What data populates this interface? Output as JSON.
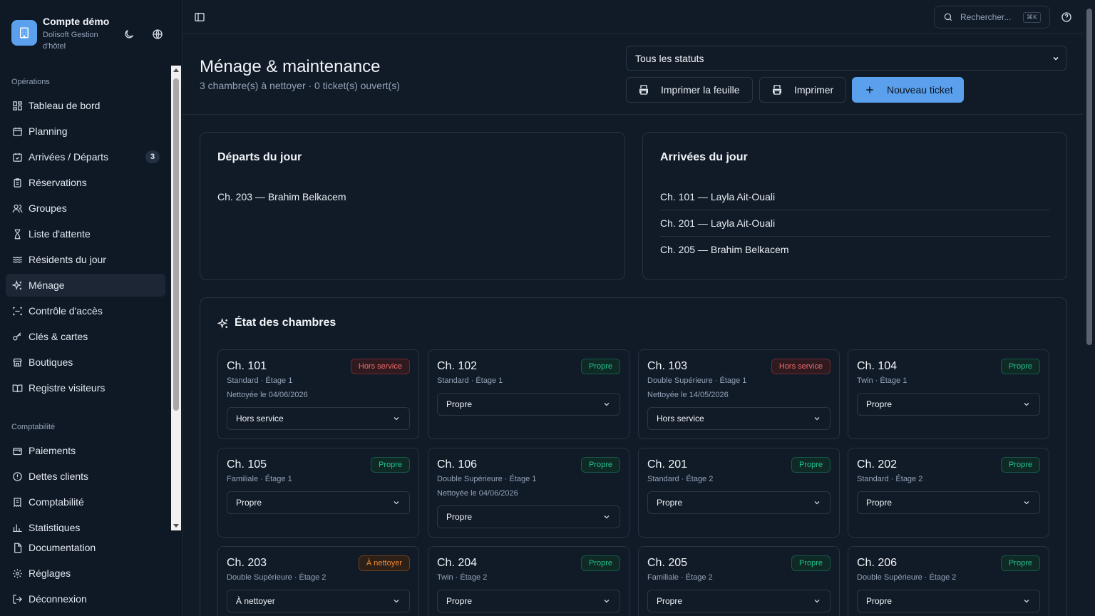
{
  "brand": {
    "title": "Compte démo",
    "subtitle": "Dolisoft Gestion d'hôtel"
  },
  "sidebar": {
    "operations_label": "Opérations",
    "operations": [
      {
        "label": "Tableau de bord",
        "icon": "dashboard-icon"
      },
      {
        "label": "Planning",
        "icon": "calendar-icon"
      },
      {
        "label": "Arrivées / Départs",
        "icon": "calendar-check-icon",
        "badge": "3"
      },
      {
        "label": "Réservations",
        "icon": "clipboard-icon"
      },
      {
        "label": "Groupes",
        "icon": "users-icon"
      },
      {
        "label": "Liste d'attente",
        "icon": "hourglass-icon"
      },
      {
        "label": "Résidents du jour",
        "icon": "waves-icon"
      },
      {
        "label": "Ménage",
        "icon": "sparkles-icon",
        "active": true
      },
      {
        "label": "Contrôle d'accès",
        "icon": "scan-icon"
      },
      {
        "label": "Clés & cartes",
        "icon": "key-icon"
      },
      {
        "label": "Boutiques",
        "icon": "store-icon"
      },
      {
        "label": "Registre visiteurs",
        "icon": "book-icon"
      }
    ],
    "accounting_label": "Comptabilité",
    "accounting": [
      {
        "label": "Paiements",
        "icon": "wallet-icon"
      },
      {
        "label": "Dettes clients",
        "icon": "alert-circle-icon"
      },
      {
        "label": "Comptabilité",
        "icon": "receipt-icon"
      },
      {
        "label": "Statistiques",
        "icon": "bar-chart-icon"
      }
    ],
    "footer": [
      {
        "label": "Documentation",
        "icon": "doc-icon"
      },
      {
        "label": "Réglages",
        "icon": "gear-icon"
      },
      {
        "label": "Déconnexion",
        "icon": "logout-icon"
      }
    ]
  },
  "topbar": {
    "search_placeholder": "Rechercher...",
    "search_shortcut": "⌘K"
  },
  "header": {
    "title": "Ménage & maintenance",
    "subtitle": "3 chambre(s) à nettoyer · 0 ticket(s) ouvert(s)",
    "status_filter": "Tous les statuts",
    "print_sheet": "Imprimer la feuille",
    "print": "Imprimer",
    "new_ticket": "Nouveau ticket"
  },
  "departures": {
    "title": "Départs du jour",
    "items": [
      "Ch. 203 — Brahim Belkacem"
    ]
  },
  "arrivals": {
    "title": "Arrivées du jour",
    "items": [
      "Ch. 101 — Layla Ait-Ouali",
      "Ch. 201 — Layla Ait-Ouali",
      "Ch. 205 — Brahim Belkacem"
    ]
  },
  "rooms": {
    "title": "État des chambres",
    "items": [
      {
        "name": "Ch. 101",
        "type": "Standard · Étage 1",
        "cleaned": "Nettoyée le 04/06/2026",
        "status": "Hors service",
        "tone": "red",
        "select": "Hors service"
      },
      {
        "name": "Ch. 102",
        "type": "Standard · Étage 1",
        "cleaned": "",
        "status": "Propre",
        "tone": "green",
        "select": "Propre"
      },
      {
        "name": "Ch. 103",
        "type": "Double Supérieure · Étage 1",
        "cleaned": "Nettoyée le 14/05/2026",
        "status": "Hors service",
        "tone": "red",
        "select": "Hors service"
      },
      {
        "name": "Ch. 104",
        "type": "Twin · Étage 1",
        "cleaned": "",
        "status": "Propre",
        "tone": "green",
        "select": "Propre"
      },
      {
        "name": "Ch. 105",
        "type": "Familiale · Étage 1",
        "cleaned": "",
        "status": "Propre",
        "tone": "green",
        "select": "Propre"
      },
      {
        "name": "Ch. 106",
        "type": "Double Supérieure · Étage 1",
        "cleaned": "Nettoyée le 04/06/2026",
        "status": "Propre",
        "tone": "green",
        "select": "Propre"
      },
      {
        "name": "Ch. 201",
        "type": "Standard · Étage 2",
        "cleaned": "",
        "status": "Propre",
        "tone": "green",
        "select": "Propre"
      },
      {
        "name": "Ch. 202",
        "type": "Standard · Étage 2",
        "cleaned": "",
        "status": "Propre",
        "tone": "green",
        "select": "Propre"
      },
      {
        "name": "Ch. 203",
        "type": "Double Supérieure · Étage 2",
        "cleaned": "",
        "status": "À nettoyer",
        "tone": "orange",
        "select": "À nettoyer"
      },
      {
        "name": "Ch. 204",
        "type": "Twin · Étage 2",
        "cleaned": "",
        "status": "Propre",
        "tone": "green",
        "select": "Propre"
      },
      {
        "name": "Ch. 205",
        "type": "Familiale · Étage 2",
        "cleaned": "",
        "status": "Propre",
        "tone": "green",
        "select": "Propre"
      },
      {
        "name": "Ch. 206",
        "type": "Double Supérieure · Étage 2",
        "cleaned": "",
        "status": "Propre",
        "tone": "green",
        "select": "Propre"
      }
    ]
  },
  "colors": {
    "accent": "#5aa0ec",
    "background": "#111a27",
    "sidebar": "#0f1825",
    "green": "#22c08b",
    "red": "#ef6b6b",
    "orange": "#f08a36"
  }
}
